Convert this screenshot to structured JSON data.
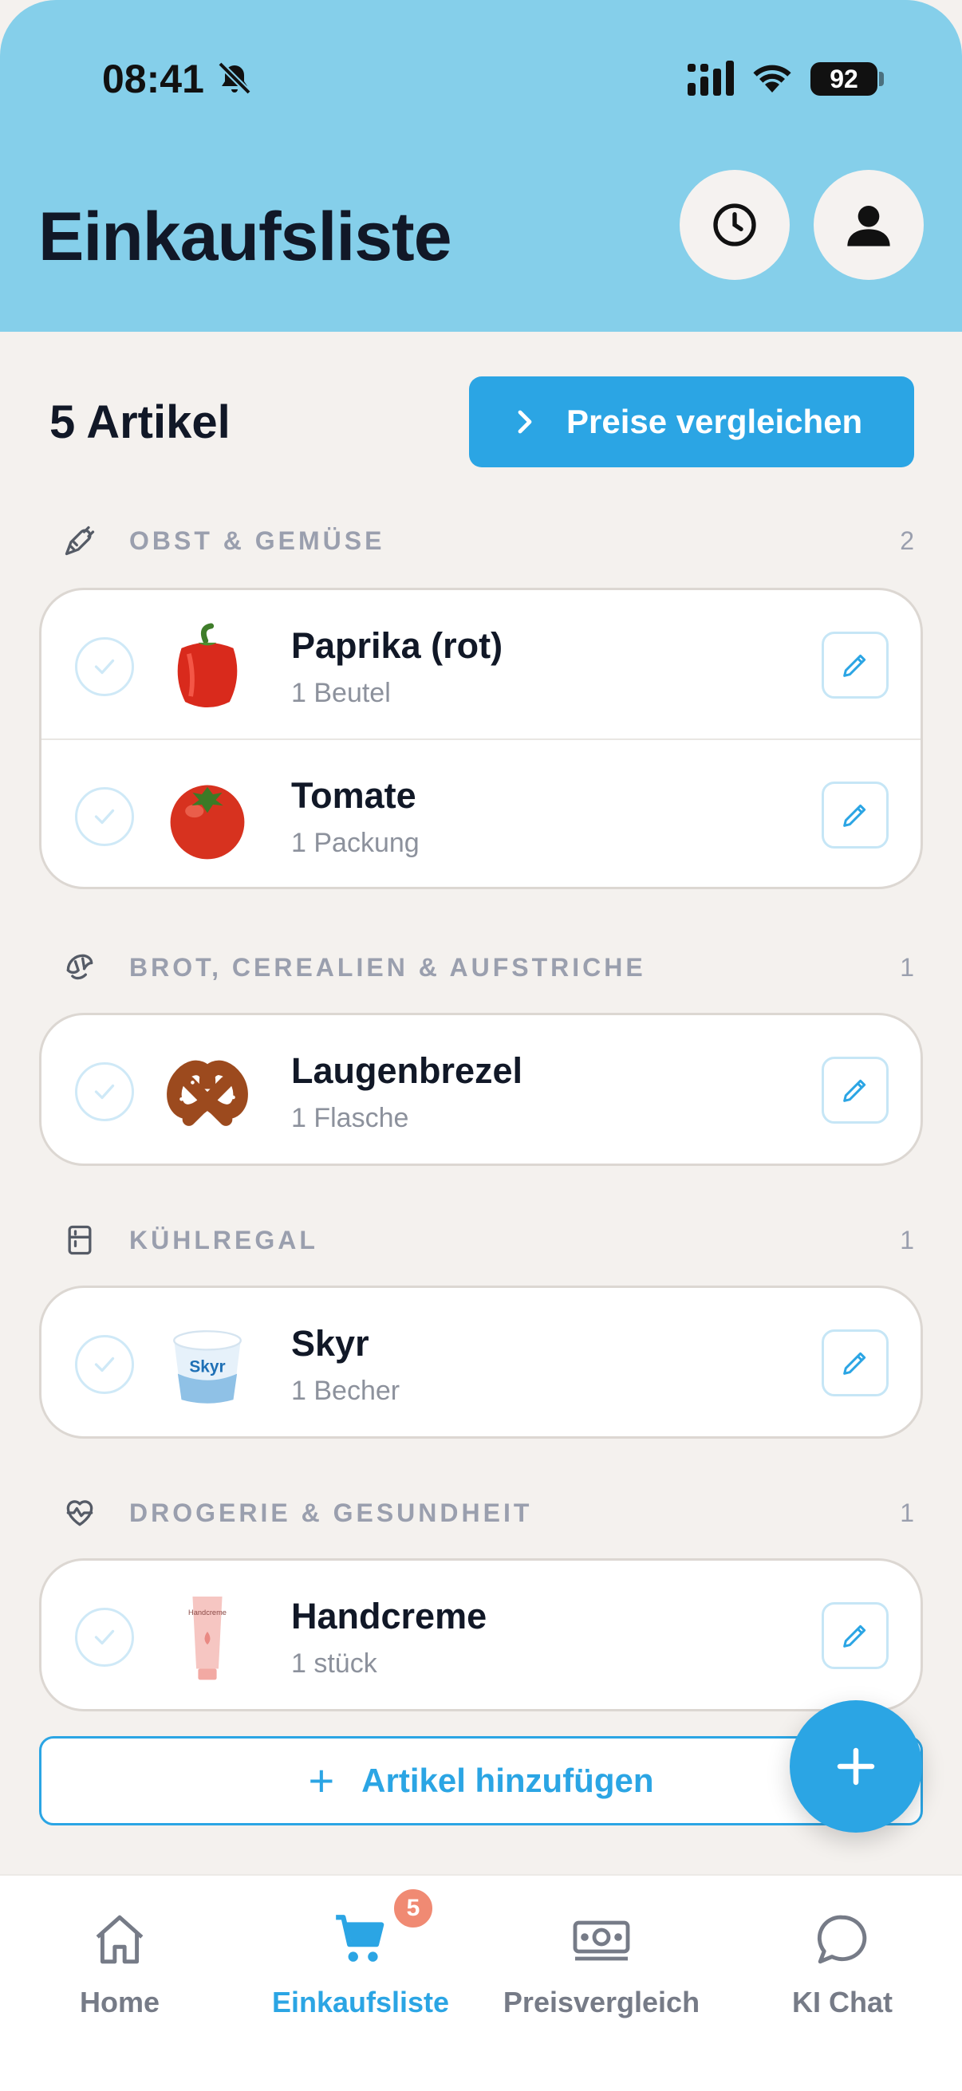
{
  "status_bar": {
    "time": "08:41",
    "battery": "92"
  },
  "header": {
    "title": "Einkaufsliste"
  },
  "summary": {
    "count_label": "5 Artikel",
    "compare_label": "Preise vergleichen"
  },
  "categories": [
    {
      "name": "OBST & GEMÜSE",
      "count": "2",
      "icon": "carrot-icon",
      "items": [
        {
          "name": "Paprika (rot)",
          "qty": "1 Beutel",
          "image": "paprika"
        },
        {
          "name": "Tomate",
          "qty": "1 Packung",
          "image": "tomato"
        }
      ]
    },
    {
      "name": "BROT, CEREALIEN & AUFSTRICHE",
      "count": "1",
      "icon": "croissant-icon",
      "items": [
        {
          "name": "Laugenbrezel",
          "qty": "1 Flasche",
          "image": "pretzel"
        }
      ]
    },
    {
      "name": "KÜHLREGAL",
      "count": "1",
      "icon": "fridge-icon",
      "items": [
        {
          "name": "Skyr",
          "qty": "1 Becher",
          "image": "skyr",
          "image_text": "Skyr"
        }
      ]
    },
    {
      "name": "DROGERIE & GESUNDHEIT",
      "count": "1",
      "icon": "heart-pulse-icon",
      "items": [
        {
          "name": "Handcreme",
          "qty": "1 stück",
          "image": "handcream",
          "image_text": "Handcreme"
        }
      ]
    }
  ],
  "add_item_label": "Artikel hinzufügen",
  "bottom_nav": {
    "items": [
      {
        "label": "Home",
        "icon": "home-icon"
      },
      {
        "label": "Einkaufsliste",
        "icon": "cart-icon",
        "active": true,
        "badge": "5"
      },
      {
        "label": "Preisvergleich",
        "icon": "banknote-icon"
      },
      {
        "label": "KI Chat",
        "icon": "chat-bubble-icon"
      }
    ]
  },
  "colors": {
    "header_bg": "#85cfea",
    "accent": "#2ba5e4",
    "background": "#f4f1ee",
    "badge": "#f08a73"
  }
}
